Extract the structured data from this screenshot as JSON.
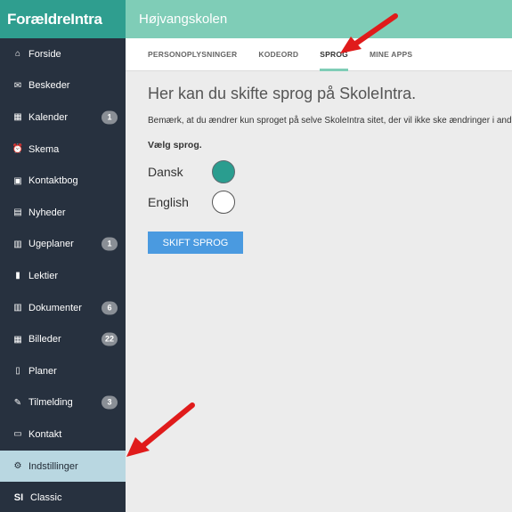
{
  "app": {
    "logo": "ForældreIntra",
    "school": "Højvangskolen"
  },
  "sidebar": {
    "items": [
      {
        "label": "Forside",
        "icon": "home-icon",
        "glyph": "⌂",
        "badge": ""
      },
      {
        "label": "Beskeder",
        "icon": "envelope-icon",
        "glyph": "✉",
        "badge": ""
      },
      {
        "label": "Kalender",
        "icon": "calendar-icon",
        "glyph": "▦",
        "badge": "1"
      },
      {
        "label": "Skema",
        "icon": "clock-icon",
        "glyph": "⏰",
        "badge": ""
      },
      {
        "label": "Kontaktbog",
        "icon": "contact-book-icon",
        "glyph": "▣",
        "badge": ""
      },
      {
        "label": "Nyheder",
        "icon": "news-icon",
        "glyph": "▤",
        "badge": ""
      },
      {
        "label": "Ugeplaner",
        "icon": "document-icon",
        "glyph": "▥",
        "badge": "1"
      },
      {
        "label": "Lektier",
        "icon": "book-icon",
        "glyph": "▮",
        "badge": ""
      },
      {
        "label": "Dokumenter",
        "icon": "file-icon",
        "glyph": "▥",
        "badge": "6"
      },
      {
        "label": "Billeder",
        "icon": "images-icon",
        "glyph": "▦",
        "badge": "22"
      },
      {
        "label": "Planer",
        "icon": "clipboard-icon",
        "glyph": "▯",
        "badge": ""
      },
      {
        "label": "Tilmelding",
        "icon": "edit-icon",
        "glyph": "✎",
        "badge": "3"
      },
      {
        "label": "Kontakt",
        "icon": "contact-card-icon",
        "glyph": "▭",
        "badge": ""
      },
      {
        "label": "Indstillinger",
        "icon": "gear-icon",
        "glyph": "⚙",
        "badge": ""
      },
      {
        "label": "Classic",
        "icon": "skoleintra-logo-icon",
        "glyph": "SI",
        "badge": ""
      }
    ],
    "active_index": 13
  },
  "tabs": [
    {
      "label": "PERSONOPLYSNINGER"
    },
    {
      "label": "KODEORD"
    },
    {
      "label": "SPROG"
    },
    {
      "label": "MINE APPS"
    }
  ],
  "active_tab": 2,
  "main": {
    "heading": "Her kan du skifte sprog på SkoleIntra.",
    "notice": "Bemærk, at du ændrer kun sproget på selve SkoleIntra sitet, der vil ikke ske ændringer i andre systemer.",
    "choose_label": "Vælg sprog.",
    "languages": [
      {
        "label": "Dansk",
        "selected": true
      },
      {
        "label": "English",
        "selected": false
      }
    ],
    "submit_label": "SKIFT SPROG"
  },
  "colors": {
    "sidebar_bg": "#27313f",
    "logo_bg": "#2f9e8f",
    "topbar_bg": "#7fcdb7",
    "active_item_bg": "#b9d7e1",
    "radio_selected": "#2a9d8f",
    "button_bg": "#4a9ae0",
    "annotation_arrow": "#e01b1b"
  }
}
